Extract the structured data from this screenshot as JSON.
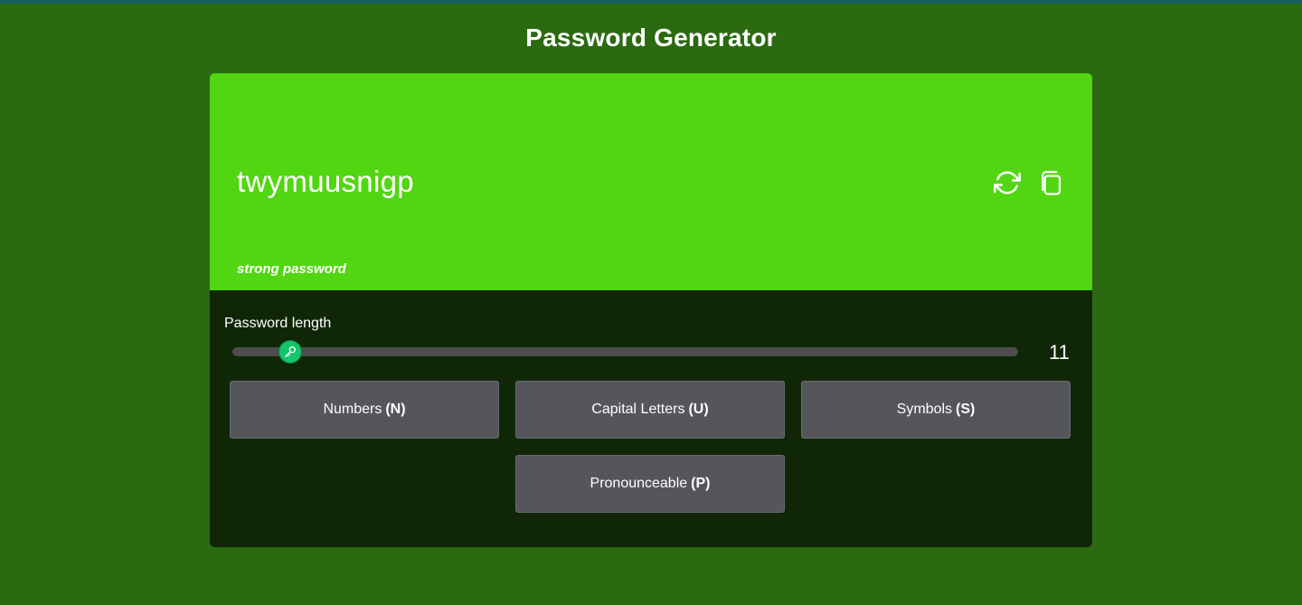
{
  "app": {
    "title": "Password Generator"
  },
  "display": {
    "password": "twymuusnigp",
    "strength": "strong password",
    "refresh_icon": "refresh-icon",
    "copy_icon": "copy-icon",
    "bg_color": "#52d612"
  },
  "length": {
    "label": "Password length",
    "value": "11",
    "min": 4,
    "max": 99,
    "thumb_icon": "key-icon"
  },
  "options": [
    {
      "label": "Numbers",
      "key": "(N)"
    },
    {
      "label": "Capital Letters",
      "key": "(U)"
    },
    {
      "label": "Symbols",
      "key": "(S)"
    },
    {
      "label": "Pronounceable",
      "key": "(P)"
    }
  ],
  "colors": {
    "page_bg": "#2b6a10",
    "panel_bg": "#0f2707",
    "button_bg": "#55555c",
    "slider_thumb": "#13c56b"
  }
}
